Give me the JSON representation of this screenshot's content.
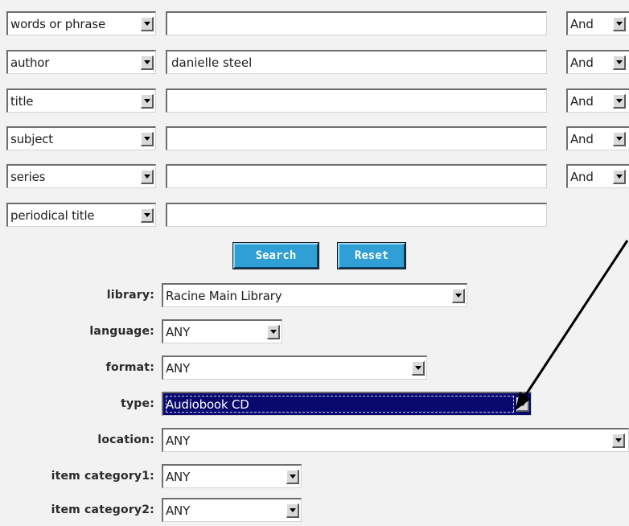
{
  "search_rows": [
    {
      "field": "words or phrase",
      "value": "",
      "operator": "And"
    },
    {
      "field": "author",
      "value": "danielle steel",
      "operator": "And"
    },
    {
      "field": "title",
      "value": "",
      "operator": "And"
    },
    {
      "field": "subject",
      "value": "",
      "operator": "And"
    },
    {
      "field": "series",
      "value": "",
      "operator": "And"
    },
    {
      "field": "periodical title",
      "value": ""
    }
  ],
  "buttons": {
    "search": "Search",
    "reset": "Reset"
  },
  "filters": [
    {
      "label": "library:",
      "value": "Racine Main Library"
    },
    {
      "label": "language:",
      "value": "ANY"
    },
    {
      "label": "format:",
      "value": "ANY"
    },
    {
      "label": "type:",
      "value": "Audiobook CD"
    },
    {
      "label": "location:",
      "value": "ANY"
    },
    {
      "label": "item category1:",
      "value": "ANY"
    },
    {
      "label": "item category2:",
      "value": "ANY"
    }
  ],
  "colors": {
    "button_bg": "#2f9fd6",
    "selected_bg": "#08086e",
    "page_bg": "#f2f2f2"
  },
  "annotation": {
    "type": "arrow",
    "points_to": "type dropdown button"
  }
}
